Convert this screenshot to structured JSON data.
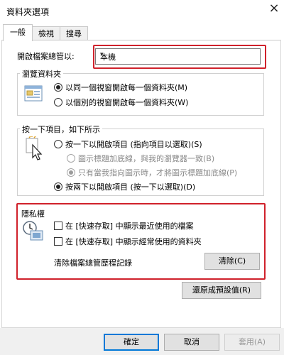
{
  "window": {
    "title": "資料夾選項",
    "close_icon": "×"
  },
  "tabs": [
    {
      "label": "一般",
      "active": true
    },
    {
      "label": "檢視",
      "active": false
    },
    {
      "label": "搜尋",
      "active": false
    }
  ],
  "browse": {
    "label": "開啟檔案總管以:",
    "selected": "本機",
    "arrow": "▾"
  },
  "browse_folders": {
    "title": "瀏覽資料夾",
    "options": [
      {
        "label": "以同一個視窗開啟每一個資料夾(M)",
        "checked": true
      },
      {
        "label": "以個別的視窗開啟每一個資料夾(W)",
        "checked": false
      }
    ]
  },
  "click_items": {
    "title": "按一下項目，如下所示",
    "options": [
      {
        "label": "按一下以開啟項目 (指向項目以選取)(S)",
        "checked": false
      },
      {
        "label": "圖示標題加底線，與我的瀏覽器一致(B)",
        "checked": false,
        "disabled": true
      },
      {
        "label": "只有當我指向圖示時，才將圖示標題加底線(P)",
        "checked": true,
        "disabled": true
      },
      {
        "label": "按兩下以開啟項目 (按一下以選取)(D)",
        "checked": true
      }
    ]
  },
  "privacy": {
    "title": "隱私權",
    "checkboxes": [
      {
        "label": "在 [快速存取] 中顯示最近使用的檔案",
        "checked": false
      },
      {
        "label": "在 [快速存取] 中顯示經常使用的資料夾",
        "checked": false
      }
    ],
    "clear_label": "清除檔案總管歷程記錄",
    "clear_button": "清除(C)"
  },
  "restore_defaults": "還原成預設值(R)",
  "footer": {
    "ok": "確定",
    "cancel": "取消",
    "apply": "套用(A)"
  },
  "colors": {
    "highlight": "#d0212b",
    "accent": "#0078d7"
  }
}
